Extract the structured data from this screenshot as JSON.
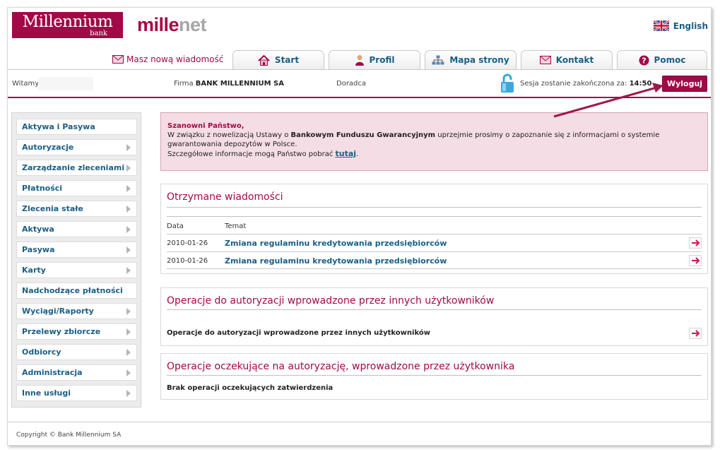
{
  "header": {
    "logo_main": "Millennium",
    "logo_sub": "bank",
    "product_a": "mille",
    "product_b": "net",
    "language": "English"
  },
  "tabs": {
    "new_message": "Masz nową wiadomość",
    "items": [
      "Start",
      "Profil",
      "Mapa strony",
      "Kontakt",
      "Pomoc"
    ]
  },
  "infobar": {
    "welcome": "Witamy",
    "firm_label": "Firma",
    "firm_name": "BANK MILLENNIUM SA",
    "advisor": "Doradca",
    "session_label": "Sesja zostanie zakończona za:",
    "session_time": "14:50",
    "logout": "Wyloguj"
  },
  "sidebar": {
    "items": [
      "Aktywa i Pasywa",
      "Autoryzacje",
      "Zarządzanie zleceniami",
      "Płatności",
      "Zlecenia stałe",
      "Aktywa",
      "Pasywa",
      "Karty",
      "Nadchodzące płatności",
      "Wyciągi/Raporty",
      "Przelewy zbiorcze",
      "Odbiorcy",
      "Administracja",
      "Inne usługi"
    ]
  },
  "notice": {
    "title": "Szanowni Państwo,",
    "text1": "W związku z nowelizacją Ustawy o ",
    "text_bold": "Bankowym Funduszu Gwarancyjnym",
    "text2": " uprzejmie prosimy o zapoznanie się z informacjami o systemie gwarantowania depozytów w Polsce.",
    "text3": "Szczegółowe informacje mogą Państwo pobrać ",
    "link": "tutaj",
    "text4": "."
  },
  "messages": {
    "title": "Otrzymane wiadomości",
    "col_date": "Data",
    "col_subject": "Temat",
    "rows": [
      {
        "date": "2010-01-26",
        "subject": "Zmiana regulaminu kredytowania przedsiębiorców"
      },
      {
        "date": "2010-01-26",
        "subject": "Zmiana regulaminu kredytowania przedsiębiorców"
      }
    ]
  },
  "auth_others": {
    "title": "Operacje do autoryzacji wprowadzone przez innych użytkowników",
    "row": "Operacje do autoryzacji wprowadzone przez innych użytkowników"
  },
  "pending": {
    "title": "Operacje oczekujące na autoryzację, wprowadzone przez użytkownika",
    "row": "Brak operacji oczekujących zatwierdzenia"
  },
  "footer": {
    "copyright": "Copyright © Bank Millennium SA"
  }
}
